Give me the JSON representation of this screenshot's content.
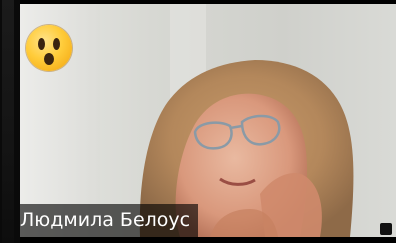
{
  "participant": {
    "name": "Людмила Белоус"
  },
  "reaction": {
    "icon": "surprised-face-emoji-icon"
  },
  "colors": {
    "label_bg": "#000000",
    "label_text": "#ffffff",
    "wall": "#d9dad6",
    "hair": "#b78a5e"
  }
}
